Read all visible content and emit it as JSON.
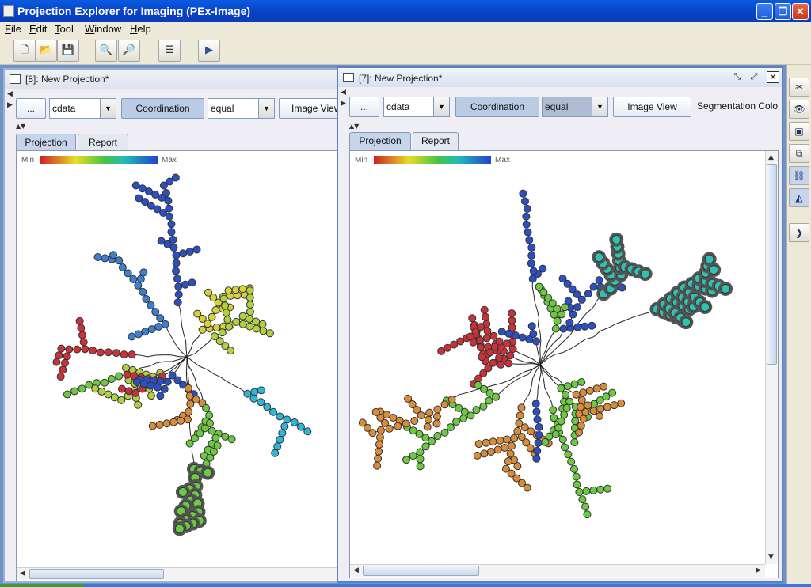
{
  "app": {
    "title": "Projection Explorer for Imaging (PEx-Image)"
  },
  "window_buttons": {
    "minimize": "_",
    "maximize": "❐",
    "close": "✕"
  },
  "menu": [
    "File",
    "Edit",
    "Tool",
    "Window",
    "Help"
  ],
  "toolbar": {
    "buttons": [
      {
        "name": "new-projection-button",
        "icon": "new-document-icon",
        "glyph": "🗋"
      },
      {
        "name": "open-button",
        "icon": "open-folder-icon",
        "glyph": "📂"
      },
      {
        "name": "save-button",
        "icon": "floppy-disk-icon",
        "glyph": "💾"
      },
      {
        "name": "zoom-in-button",
        "icon": "zoom-in-icon",
        "glyph": "🔍"
      },
      {
        "name": "zoom-out-button",
        "icon": "zoom-out-icon",
        "glyph": "🔎"
      },
      {
        "name": "properties-button",
        "icon": "list-properties-icon",
        "glyph": "☰"
      },
      {
        "name": "run-button",
        "icon": "play-icon",
        "glyph": "▶"
      }
    ]
  },
  "right_toolbar": [
    {
      "icon": "scissors-icon",
      "glyph": "✂"
    },
    {
      "icon": "binoculars-icon",
      "glyph": "👁"
    },
    {
      "icon": "frame-icon",
      "glyph": "▣"
    },
    {
      "icon": "copy-icon",
      "glyph": "⧉"
    },
    {
      "icon": "link-icon",
      "glyph": "⛓"
    },
    {
      "icon": "polygon-select-icon",
      "glyph": "◭"
    },
    {
      "icon": "chevron-right-icon",
      "glyph": "❯"
    }
  ],
  "frames": [
    {
      "id": "left",
      "title": "[8]: New Projection*",
      "dots_button": "...",
      "scalar_combo": "cdata",
      "coordination_button": "Coordination",
      "equal_combo": "equal",
      "image_view_button": "Image View",
      "tabs": [
        "Projection",
        "Report"
      ],
      "legend_min": "Min",
      "legend_max": "Max"
    },
    {
      "id": "right",
      "title": "[7]: New Projection*",
      "dots_button": "...",
      "scalar_combo": "cdata",
      "coordination_button": "Coordination",
      "equal_combo": "equal",
      "image_view_button": "Image View",
      "segmentation_label": "Segmentation Colo",
      "tabs": [
        "Projection",
        "Report"
      ],
      "legend_min": "Min",
      "legend_max": "Max"
    }
  ],
  "colors": {
    "red": "#c8323a",
    "yellow": "#d8d23a",
    "green": "#6cc940",
    "teal": "#2ec2b0",
    "blue": "#2d4fc4",
    "steel_blue": "#3f7fd0",
    "orange": "#d98c3a",
    "cyan": "#2fb6d8",
    "lime": "#b0d040"
  }
}
